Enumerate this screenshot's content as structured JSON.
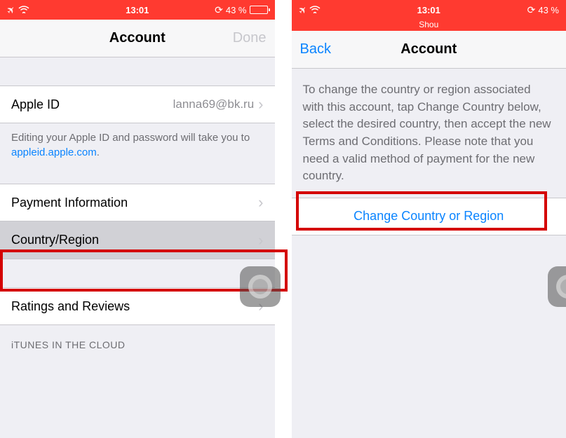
{
  "left": {
    "status": {
      "time": "13:01",
      "battery_pct": "43 %"
    },
    "nav": {
      "title": "Account",
      "done": "Done"
    },
    "apple_id": {
      "label": "Apple ID",
      "value": "lanna69@bk.ru"
    },
    "footer": {
      "text_before": "Editing your Apple ID and password will take you to ",
      "link": "appleid.apple.com",
      "text_after": "."
    },
    "payment": {
      "label": "Payment Information"
    },
    "country": {
      "label": "Country/Region"
    },
    "ratings": {
      "label": "Ratings and Reviews"
    },
    "section": {
      "label": "iTUNES IN THE CLOUD"
    }
  },
  "right": {
    "status": {
      "time": "13:01",
      "battery_pct": "43 %",
      "subtitle": "Shou"
    },
    "nav": {
      "back": "Back",
      "title": "Account"
    },
    "desc": "To change the country or region associated with this account, tap Change Country below, select the desired country, then accept the new Terms and Conditions. Please note that you need a valid method of payment for the new country.",
    "change": {
      "label": "Change Country or Region"
    }
  }
}
